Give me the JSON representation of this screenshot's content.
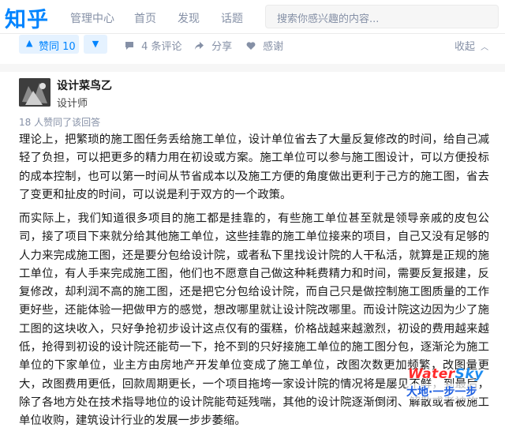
{
  "header": {
    "logo": "知乎",
    "nav": [
      "管理中心",
      "首页",
      "发现",
      "话题"
    ],
    "search_placeholder": "搜索你感兴趣的内容..."
  },
  "actions": {
    "vote_up": "赞同 10",
    "comments": "4 条评论",
    "share": "分享",
    "thanks": "感谢",
    "collapse": "收起"
  },
  "author": {
    "name": "设计菜鸟乙",
    "headline": "设计师"
  },
  "answer": {
    "vote_note": "18 人赞同了该回答",
    "paragraphs": [
      "理论上，把繁琐的施工图任务丢给施工单位，设计单位省去了大量反复修改的时间，给自己减轻了负担，可以把更多的精力用在初设或方案。施工单位可以参与施工图设计，可以方便投标的成本控制，也可以第一时间从节省成本以及施工方便的角度做出更利于己方的施工图，省去了变更和扯皮的时间，可以说是利于双方的一个政策。",
      "而实际上，我们知道很多项目的施工都是挂靠的，有些施工单位甚至就是领导亲戚的皮包公司，接了项目下来就分给其他施工单位，这些挂靠的施工单位接来的项目，自己又没有足够的人力来完成施工图，还是要分包给设计院，或者私下里找设计院的人干私活，就算是正规的施工单位，有人手来完成施工图，他们也不愿意自己做这种耗费精力和时间，需要反复报建，反复修改，却利润不高的施工图，还是把它分包给设计院，而自己只是做控制施工图质量的工作更好些，还能体验一把做甲方的感觉，想改哪里就让设计院改哪里。而设计院这边因为少了施工图的这块收入，只好争抢初步设计这点仅有的蛋糕，价格战越来越激烈，初设的费用越来越低，抢得到初设的设计院还能苟一下，抢不到的只好接施工单位的施工图分包，逐渐沦为施工单位的下家单位，业主方由房地产开发单位变成了施工单位，改图次数更加频繁，改图量更大，改图费用更低，回款周期更长，一个项目拖垮一家设计院的情况将是屡见不鲜，到最后，除了各地方处在技术指导地位的设计院能苟延残喘，其他的设计院逐渐倒闭、解散或者被施工单位收购，建筑设计行业的发展一步步萎缩。"
    ]
  },
  "watermark": {
    "line1a": "Water",
    "line1b": "Sky",
    "line2": "大地·一步一步"
  },
  "colors": {
    "brand": "#0084ff",
    "meta": "#8590a6",
    "divider": "#f6f6f6"
  }
}
